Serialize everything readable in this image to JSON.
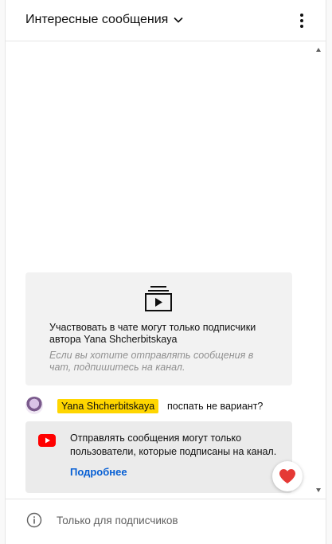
{
  "header": {
    "title": "Интересные сообщения"
  },
  "members_card": {
    "title": "Участвовать в чате могут только подписчики автора Yana Shcherbitskaya",
    "subtitle": "Если вы хотите отправлять сообщения в чат, подпишитесь на канал."
  },
  "chat": {
    "author": "Yana Shcherbitskaya",
    "message": "поспать не вариант?"
  },
  "notice": {
    "text": "Отправлять сообщения могут только пользователи, которые подписаны на канал.",
    "link": "Подробнее"
  },
  "footer": {
    "text": "Только для подписчиков"
  },
  "colors": {
    "author_badge": "#ffd600",
    "link": "#065fd4",
    "youtube_red": "#ff0000",
    "heart": "#e53935"
  },
  "icons": {
    "header_dropdown": "chevron-down-icon",
    "menu": "more-vert-icon",
    "members": "subscriptions-icon",
    "notice": "youtube-logo-icon",
    "reaction": "heart-icon",
    "footer": "info-icon"
  }
}
